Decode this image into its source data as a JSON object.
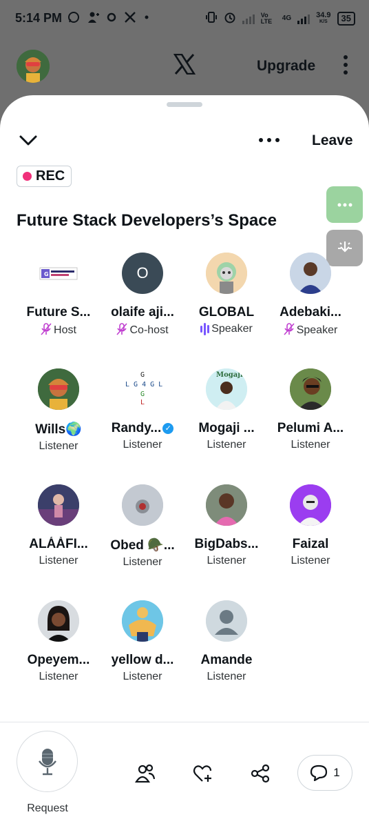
{
  "statusbar": {
    "time": "5:14 PM",
    "network_speed": "34.9",
    "network_speed_unit": "K/S",
    "network_type": "4G",
    "volte": "Vo LTE",
    "battery": "35"
  },
  "appbar": {
    "upgrade_label": "Upgrade"
  },
  "space": {
    "leave_label": "Leave",
    "rec_label": "REC",
    "title": "Future Stack Developers’s Space",
    "accent": "#f0307a"
  },
  "participants": [
    {
      "name": "Future S...",
      "role": "Host",
      "status": "muted"
    },
    {
      "name": "olaife aji...",
      "role": "Co-host",
      "status": "muted",
      "initial": "O"
    },
    {
      "name": "GLOBAL",
      "role": "Speaker",
      "status": "speaking"
    },
    {
      "name": "Adebaki...",
      "role": "Speaker",
      "status": "muted"
    },
    {
      "name": "Wills🌍",
      "role": "Listener"
    },
    {
      "name": "Randy...",
      "role": "Listener",
      "verified": true
    },
    {
      "name": "Mogaji ...",
      "role": "Listener"
    },
    {
      "name": "Pelumi A...",
      "role": "Listener"
    },
    {
      "name": "ALÁÀFI...",
      "role": "Listener"
    },
    {
      "name": "Obed 🪖...",
      "role": "Listener"
    },
    {
      "name": "BigDabs...",
      "role": "Listener"
    },
    {
      "name": "Faizal",
      "role": "Listener"
    },
    {
      "name": "Opeyem...",
      "role": "Listener"
    },
    {
      "name": "yellow d...",
      "role": "Listener"
    },
    {
      "name": "Amande",
      "role": "Listener"
    }
  ],
  "bottombar": {
    "request_label": "Request",
    "comment_count": "1"
  },
  "icons": [
    "whatsapp-icon",
    "add-user-icon",
    "x-logo-icon",
    "vibrate-icon",
    "alarm-icon",
    "chevron-down-icon",
    "more-icon",
    "microphone-icon",
    "people-icon",
    "heart-add-icon",
    "share-icon",
    "comment-icon"
  ]
}
